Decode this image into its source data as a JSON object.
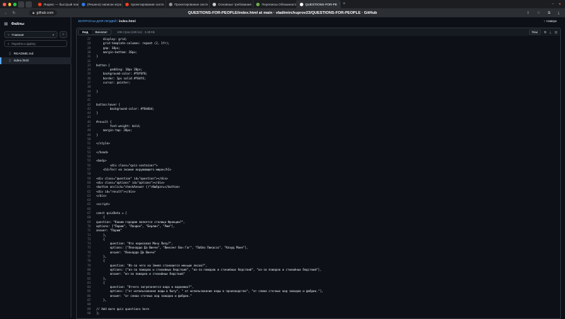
{
  "browser": {
    "tabs": [
      {
        "title": "Яндекс — быстрый поиск",
        "color": "#fc3f1d",
        "active": false
      },
      {
        "title": "(Решено) написан игра",
        "color": "#2b7de9",
        "active": false
      },
      {
        "title": "проектирование систе",
        "color": "#fc3f1d",
        "active": false
      },
      {
        "title": "Проектирование систе",
        "color": "#8b949e",
        "active": false
      },
      {
        "title": "Основные требования",
        "color": "#cccccc",
        "active": false
      },
      {
        "title": "Перепиcка Обязанности",
        "color": "#6fae4c",
        "active": false
      },
      {
        "title": "QUESTIONS-FOR-PE",
        "color": "#ffffff",
        "active": true
      }
    ],
    "address": "github.com",
    "page_title": "QUESTIONS-FOR-PEOPLE/index.html at main · vladimirchuprov23/QUESTIONS-FOR-PEOPLE · GitHub"
  },
  "sidebar": {
    "title": "Файлы",
    "branch": "Главная",
    "search_placeholder": "Перейти к файлу",
    "files": [
      {
        "name": "README.md",
        "active": false
      },
      {
        "name": "index.html",
        "active": true
      }
    ]
  },
  "breadcrumb": {
    "repo": "ВОПРОСЫ-ДЛЯ-ЛЮДЕЙ",
    "sep": "/",
    "file": "index.html"
  },
  "top_button": "Наверх",
  "file_header": {
    "tab_code": "Код",
    "tab_blame": "Виноват",
    "info": "106 строк (106 loc) · 3.48 КБ",
    "raw": "Raw"
  },
  "code_start_line": 27,
  "code_lines": [
    "    display: grid;",
    "    grid-template-columns: repeat (2, 1fr);",
    "    gap: 10px;",
    "    margin-bottom: 20px;",
    "}",
    "",
    "button {",
    "        padding: 10px 20px;",
    "    background-color: #f0f0f0;",
    "    border: 1px solid #f0df4;",
    "    cursor: pointer;",
    "",
    "}",
    "",
    "",
    "button:hover {",
    "        background-color: #f0d4b4;",
    "}",
    "",
    "#result {",
    "        font-weight: bold;",
    "    margin-top: 20px;",
    "}",
    "",
    "</style>",
    "",
    "</head>",
    "",
    "<body>",
    "        <div class=\"quiz-container\">",
    "    <h1>Тест на знание окружающего мира</h1>",
    "",
    "<div class=\"question\" id=\"question\"></div>",
    "<div class=\"options\" id=\"options\"></div>",
    "<button onclick=\"checkAnswer ()\">Выбрать</button>",
    "<div id=\"result\"></div>",
    "</div>",
    "",
    "<script>",
    "",
    "const quizData = [",
    "    {",
    "question: \"Каким городом является столица Франции?\",",
    "options: [\"Париж\", \"Лондон\", \"Берлин\", \"Рим\"],",
    "answer: \"Париж\"",
    "    },",
    "    {",
    "        question: \"Кто нарисовал Мону Лизу?\",",
    "        options: [\"Леонардо Да Винчи\", \"Винсент Ван Гог\", \"Пабло Пикассо\", \"Клауд Моне\"],",
    "        answer: \"Леонардо Да Винчи\"",
    "    },",
    "    {",
    "        question: \"Из-за чего на Земле становится меньше лесов?\",",
    "        options: [\"из-за пожаров и стихийных бедствий\", \"из-за пожаров и стихийных бедствий\", \"из-за пожаров и стихийных бедствий\"],",
    "        answer: \"из-за пожаров и стихийных бедствий\"",
    "    },",
    "    {",
    "        question: \"Отчего загрязняется вода в водоемах?\",",
    "        options: [\"от использования воды в быту\", \" от использования воды в производстве\", \"от слива сточных вод заводов и фабрик.\"],",
    "        answer: \"от слива сточных вод заводов и фабрик.\"",
    "    },",
    "",
    "// Add more quiz questions here",
    "];"
  ]
}
